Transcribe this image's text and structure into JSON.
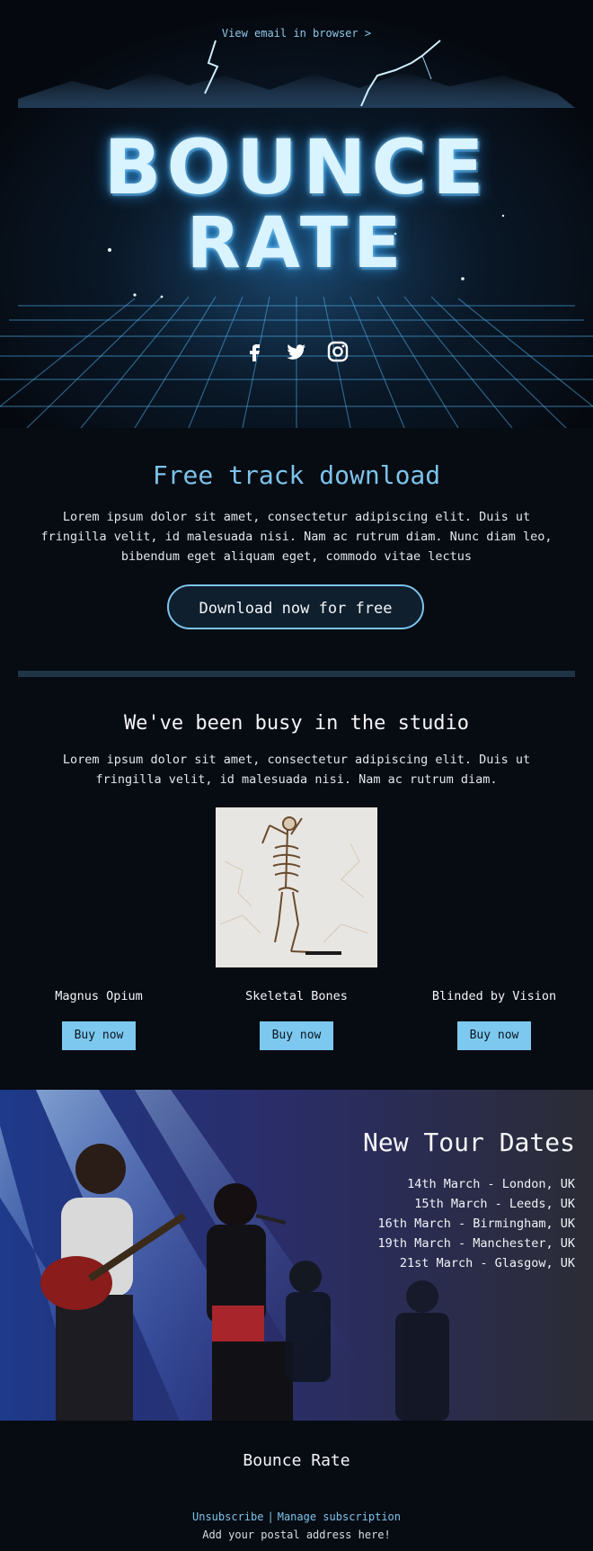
{
  "hero": {
    "view_in_browser": "View email in browser >",
    "logo_line1": "BOUNCE",
    "logo_line2": "RATE",
    "social_icons": [
      "facebook-icon",
      "twitter-icon",
      "instagram-icon"
    ]
  },
  "free_track": {
    "title": "Free track download",
    "body": "Lorem ipsum dolor sit amet, consectetur adipiscing elit. Duis ut fringilla velit, id malesuada nisi. Nam ac rutrum diam. Nunc diam leo, bibendum eget aliquam eget, commodo vitae lectus",
    "button_label": "Download now for free"
  },
  "studio": {
    "title": "We've been busy in the studio",
    "body": "Lorem ipsum dolor sit amet, consectetur adipiscing elit. Duis ut fringilla velit, id malesuada nisi. Nam ac rutrum diam.",
    "albums": [
      {
        "name": "Magnus Opium",
        "button": "Buy now"
      },
      {
        "name": "Skeletal Bones",
        "button": "Buy now"
      },
      {
        "name": "Blinded by Vision",
        "button": "Buy now"
      }
    ]
  },
  "tour": {
    "title": "New Tour Dates",
    "dates": [
      "14th March - London, UK",
      "15th March - Leeds, UK",
      "16th March - Birmingham, UK",
      "19th March - Manchester, UK",
      "21st March - Glasgow, UK"
    ]
  },
  "footer": {
    "brand": "Bounce Rate",
    "unsubscribe": "Unsubscribe",
    "separator": "|",
    "manage": "Manage subscription",
    "address": "Add your postal address here!"
  },
  "colors": {
    "background": "#070b12",
    "accent": "#7cc3ea",
    "button_fill": "#7dc8ee",
    "divider": "#1f3547"
  }
}
